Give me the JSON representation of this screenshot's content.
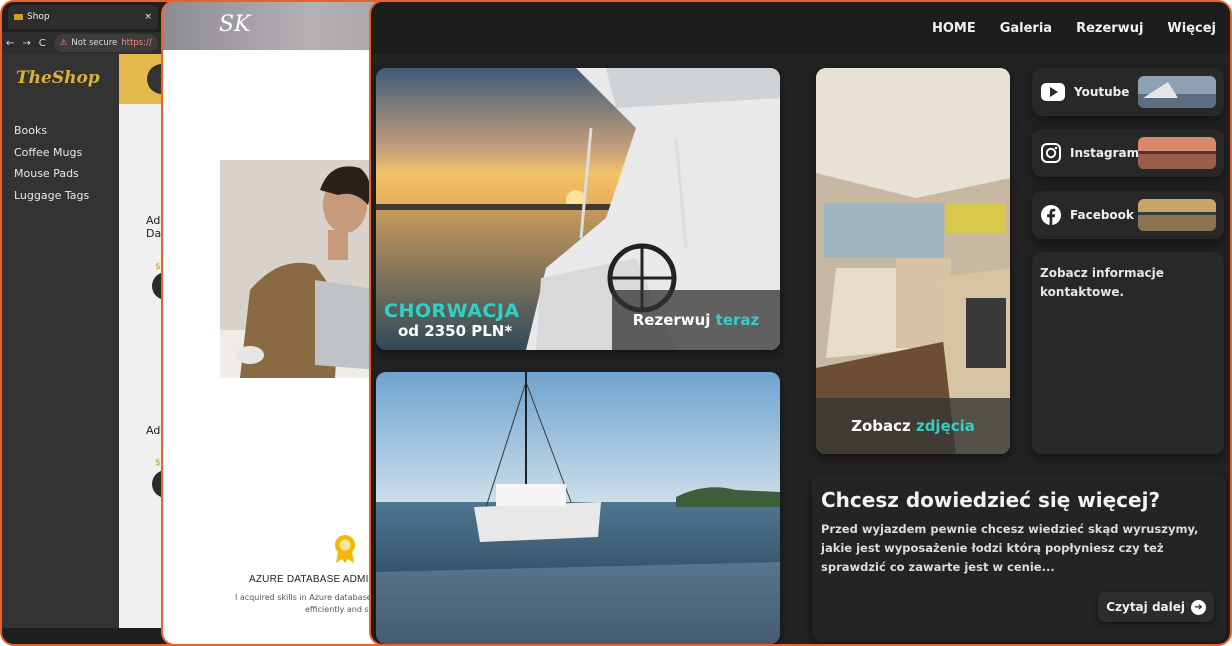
{
  "shop": {
    "tab_title": "Shop",
    "tab_close": "×",
    "not_secure": "Not secure",
    "url": "https://",
    "logo": "TheShop",
    "nav": [
      "Books",
      "Coffee Mugs",
      "Mouse Pads",
      "Luggage Tags"
    ],
    "items": [
      "Adv",
      "Dat",
      "Adv"
    ],
    "prices": [
      "$",
      "$"
    ],
    "circle": "t"
  },
  "portfolio": {
    "logo": "SK",
    "cert_title": "AZURE DATABASE ADMINISTR",
    "cert_desc_1": "I acquired skills in Azure database admi",
    "cert_desc_2": "efficiently and sec"
  },
  "catamaran": {
    "nav": [
      "HOME",
      "Galeria",
      "Rezerwuj",
      "Więcej"
    ],
    "hero": {
      "title": "CHORWACJA",
      "price": "od 2350 PLN*",
      "cta_text": "Rezerwuj ",
      "cta_accent": "teraz"
    },
    "interior": {
      "cta_text": "Zobacz ",
      "cta_accent": "zdjęcia"
    },
    "socials": [
      {
        "label": "Youtube",
        "icon": "youtube-icon"
      },
      {
        "label": "Instagram",
        "icon": "instagram-icon"
      },
      {
        "label": "Facebook",
        "icon": "facebook-icon"
      }
    ],
    "contact_line1": "Zobacz informacje",
    "contact_line2": "kontaktowe.",
    "more": {
      "title": "Chcesz dowiedzieć się więcej?",
      "body": "Przed wyjazdem pewnie chcesz wiedzieć skąd wyruszymy, jakie jest wyposażenie łodzi którą popłyniesz czy też sprawdzić co zawarte jest w cenie...",
      "read_more": "Czytaj dalej"
    }
  },
  "colors": {
    "accent": "#2fd0c6",
    "window_border": "#e8622a",
    "shop_gold": "#d9b334"
  }
}
